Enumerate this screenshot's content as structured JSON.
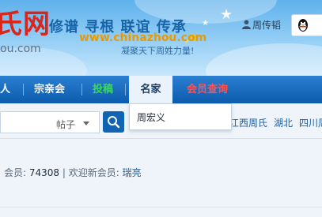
{
  "header": {
    "logo_text": "氏网",
    "logo_domain": "ou.com",
    "slogan": "修谱 寻根 联谊 传承",
    "site_url": "www.chinazhou.com",
    "tagline": "凝聚天下周姓力量!",
    "username": "周传韬",
    "qq_icon": "penguin-icon"
  },
  "nav": {
    "items": [
      {
        "label": "人"
      },
      {
        "label": "宗亲会"
      },
      {
        "label": "投稿"
      },
      {
        "label": "名家"
      },
      {
        "label": "会员查询"
      }
    ],
    "dropdown_item": "周宏义"
  },
  "search": {
    "type_value": "帖子"
  },
  "tags": [
    "江西周氏",
    "湖北",
    "四川周"
  ],
  "stats": {
    "members_label": "会员:",
    "members_value": "74308",
    "separator": "|",
    "welcome_label": "欢迎新会员:",
    "new_member": "瑞亮"
  }
}
